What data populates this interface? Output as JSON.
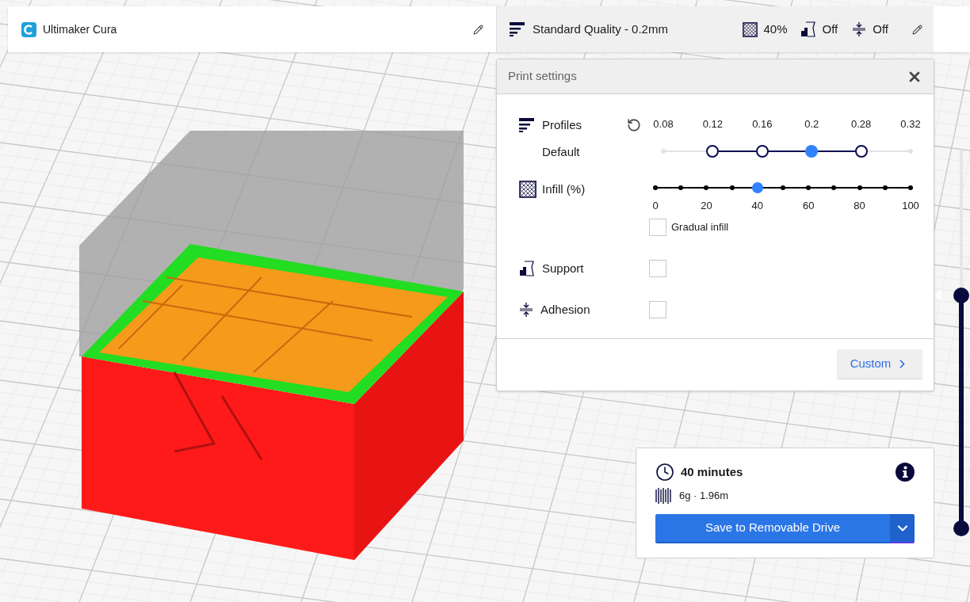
{
  "app": {
    "title": "Ultimaker Cura"
  },
  "summary": {
    "profile": "Standard Quality - 0.2mm",
    "infill": "40%",
    "support": "Off",
    "adhesion": "Off"
  },
  "print_settings": {
    "title": "Print settings",
    "profiles": {
      "label": "Profiles",
      "sublabel": "Default",
      "options": [
        {
          "label": "0.08",
          "available": false,
          "selected": false
        },
        {
          "label": "0.12",
          "available": true,
          "selected": false
        },
        {
          "label": "0.16",
          "available": true,
          "selected": false
        },
        {
          "label": "0.2",
          "available": true,
          "selected": true
        },
        {
          "label": "0.28",
          "available": true,
          "selected": false
        },
        {
          "label": "0.32",
          "available": false,
          "selected": false
        }
      ]
    },
    "infill": {
      "label": "Infill (%)",
      "level": 0.4,
      "ticks": [
        "0",
        "20",
        "40",
        "60",
        "80",
        "100"
      ],
      "gradual": {
        "label": "Gradual infill",
        "checked": false
      }
    },
    "support": {
      "label": "Support",
      "checked": false
    },
    "adhesion": {
      "label": "Adhesion",
      "checked": false
    },
    "custom_button": "Custom"
  },
  "estimate": {
    "time": "40 minutes",
    "material": "6g · 1.96m",
    "save_button": "Save to Removable Drive"
  }
}
